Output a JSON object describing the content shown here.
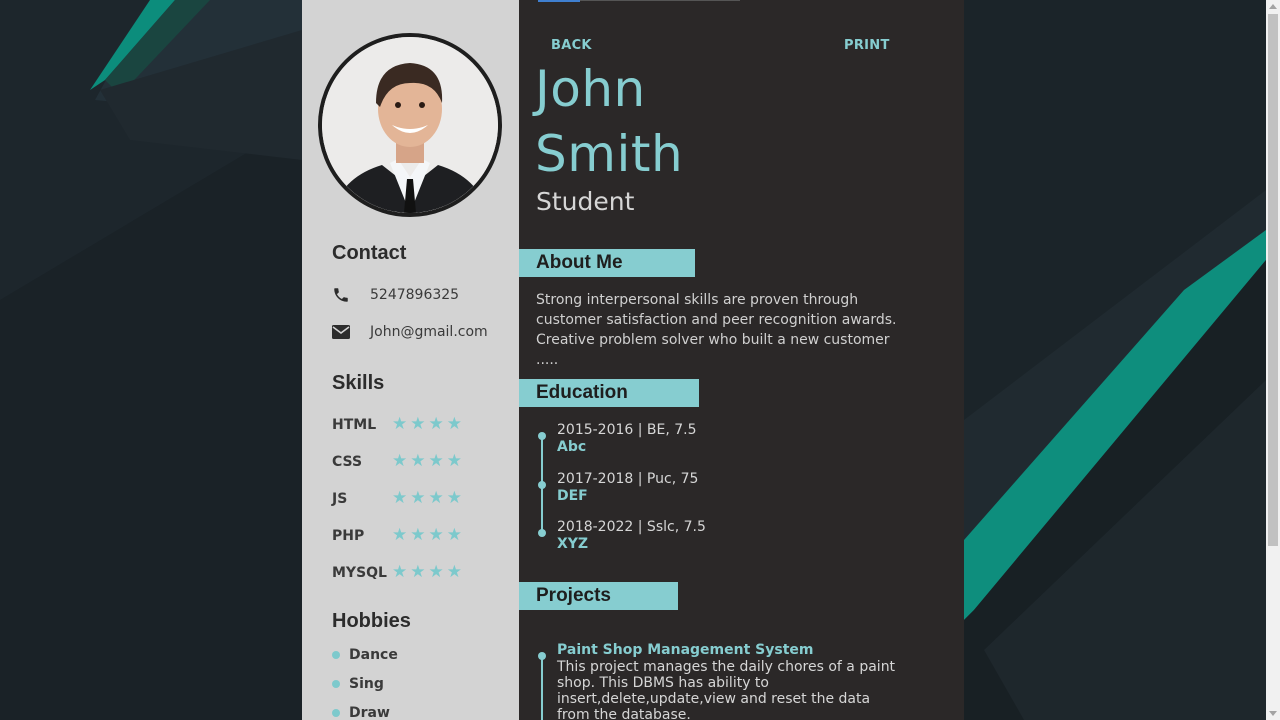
{
  "nav": {
    "back_label": "BACK",
    "print_label": "PRINT"
  },
  "profile": {
    "first_name": "John",
    "last_name": "Smith",
    "role": "Student"
  },
  "contact": {
    "title": "Contact",
    "phone": "5247896325",
    "email": "John@gmail.com",
    "phone_icon": "phone-icon",
    "email_icon": "envelope-icon"
  },
  "skills": {
    "title": "Skills",
    "items": [
      {
        "name": "HTML",
        "rating": 4,
        "max": 4
      },
      {
        "name": "CSS",
        "rating": 4,
        "max": 4
      },
      {
        "name": "JS",
        "rating": 4,
        "max": 4
      },
      {
        "name": "PHP",
        "rating": 4,
        "max": 4
      },
      {
        "name": "MYSQL",
        "rating": 4,
        "max": 4
      }
    ]
  },
  "hobbies": {
    "title": "Hobbies",
    "items": [
      "Dance",
      "Sing",
      "Draw"
    ]
  },
  "about": {
    "title": "About Me",
    "text": "Strong interpersonal skills are proven through customer satisfaction and peer recognition awards. Creative problem solver who built a new customer ....."
  },
  "education": {
    "title": "Education",
    "items": [
      {
        "details": "2015-2016 | BE, 7.5",
        "school": "Abc"
      },
      {
        "details": "2017-2018 | Puc, 75",
        "school": "DEF"
      },
      {
        "details": "2018-2022 | Sslc, 7.5",
        "school": "XYZ"
      }
    ]
  },
  "projects": {
    "title": "Projects",
    "items": [
      {
        "name": "Paint Shop Management System",
        "description": "This project manages the daily chores of a paint shop. This DBMS has ability to insert,delete,update,view and reset the data from the database."
      }
    ]
  },
  "colors": {
    "accent": "#86cdd0",
    "sidebar_bg": "#d3d3d3",
    "main_bg": "#2b2828",
    "page_bg": "#1b2329"
  }
}
